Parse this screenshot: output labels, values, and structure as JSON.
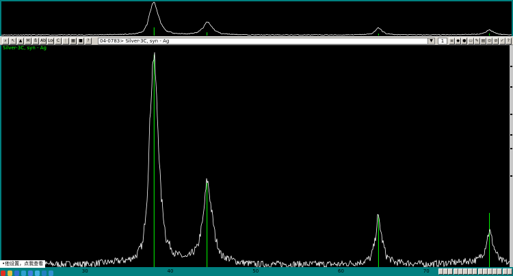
{
  "phase": {
    "pdf_card": "04-0783> Silver-3C, syn - Ag",
    "label": "Silver-3C, syn - Ag",
    "color": "#00ff00",
    "stick_lines": [
      {
        "two_theta": 38.1,
        "intensity": 100
      },
      {
        "two_theta": 44.3,
        "intensity": 40
      },
      {
        "two_theta": 64.4,
        "intensity": 25
      },
      {
        "two_theta": 77.4,
        "intensity": 26
      }
    ]
  },
  "toolbar": {
    "page_value": "1",
    "left_buttons": [
      {
        "name": "zoom-button",
        "glyph": "⌕"
      },
      {
        "name": "cursor-button",
        "glyph": "↖"
      },
      {
        "name": "peak-button",
        "glyph": "▲"
      },
      {
        "name": "overlay-button",
        "glyph": "M"
      },
      {
        "name": "label-button",
        "glyph": "ß"
      },
      {
        "name": "scale-button",
        "glyph": "Ab"
      },
      {
        "name": "log-button",
        "glyph": "Log"
      },
      {
        "name": "clear-button",
        "glyph": "C"
      },
      {
        "name": "grid-button",
        "glyph": "⋮"
      },
      {
        "name": "table-button",
        "glyph": "▦"
      },
      {
        "name": "monitor-button",
        "glyph": "■"
      },
      {
        "name": "help-button",
        "glyph": "?"
      }
    ],
    "right_buttons": [
      {
        "name": "list-button",
        "glyph": "≡"
      },
      {
        "name": "stack-button",
        "glyph": "◆"
      },
      {
        "name": "info-button",
        "glyph": "●"
      },
      {
        "name": "print-button",
        "glyph": "▭"
      },
      {
        "name": "edit-button",
        "glyph": "✎"
      },
      {
        "name": "export-button",
        "glyph": "▤"
      },
      {
        "name": "search-button",
        "glyph": "⊙"
      },
      {
        "name": "stop-button",
        "glyph": "⊘"
      },
      {
        "name": "accept-button",
        "glyph": "✓"
      },
      {
        "name": "query-button",
        "glyph": "?"
      }
    ]
  },
  "xaxis": {
    "min": 20.2,
    "max": 80.0,
    "ticks": [
      30,
      40,
      50,
      60,
      70
    ]
  },
  "taskbar": {
    "text": "•他设置，点我查看"
  },
  "chart_data": {
    "type": "line",
    "xlabel": "",
    "ylabel": "",
    "xlim": [
      20.2,
      80.0
    ],
    "ylim": [
      0,
      100
    ],
    "series": [
      {
        "x": [
          20.2,
          25,
          30,
          33,
          35,
          36,
          36.8,
          37.3,
          37.7,
          38.0,
          38.2,
          38.5,
          38.9,
          39.5,
          40.5,
          42,
          43.2,
          43.8,
          44.1,
          44.3,
          44.5,
          44.8,
          45.3,
          46,
          48,
          50,
          55,
          60,
          62.5,
          63.5,
          64.0,
          64.3,
          64.5,
          64.8,
          65.3,
          66.2,
          70,
          74,
          76,
          76.8,
          77.2,
          77.4,
          77.6,
          78.0,
          78.6,
          80.0
        ],
        "y": [
          2,
          2,
          2,
          3,
          4,
          6,
          12,
          35,
          78,
          100,
          95,
          70,
          35,
          14,
          7,
          5,
          10,
          22,
          34,
          42,
          38,
          28,
          14,
          6,
          3,
          2,
          2,
          2,
          3,
          5,
          13,
          24,
          22,
          14,
          6,
          3,
          2,
          3,
          4,
          8,
          15,
          18,
          15,
          9,
          4,
          2
        ]
      }
    ]
  }
}
